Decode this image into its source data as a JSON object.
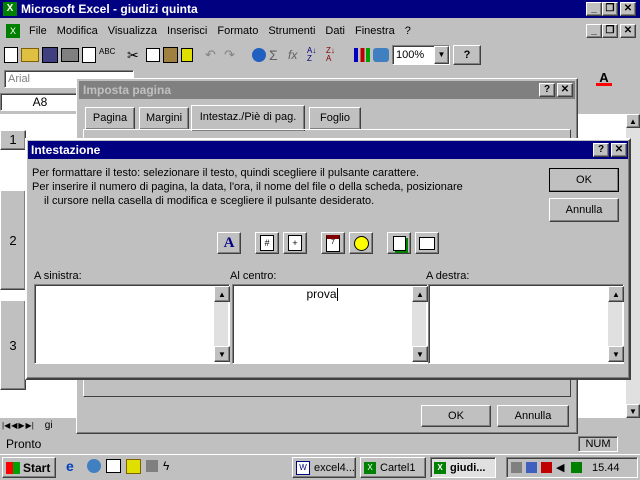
{
  "app": {
    "title": "Microsoft Excel - giudizi quinta",
    "menus": [
      "File",
      "Modifica",
      "Visualizza",
      "Inserisci",
      "Formato",
      "Strumenti",
      "Dati",
      "Finestra",
      "?"
    ],
    "zoom": "100%",
    "font_name": "Arial",
    "cell_ref": "A8",
    "row_numbers": [
      "1",
      "2",
      "3"
    ],
    "status": "Pronto",
    "num_indicator": "NUM",
    "sheet_tab": "gi"
  },
  "page_setup": {
    "title": "Imposta pagina",
    "tabs": [
      "Pagina",
      "Margini",
      "Intestaz./Piè di pag.",
      "Foglio"
    ],
    "ok_label": "OK",
    "cancel_label": "Annulla"
  },
  "header_dialog": {
    "title": "Intestazione",
    "instructions": [
      "Per formattare il testo: selezionare il testo, quindi scegliere il pulsante carattere.",
      "Per inserire il numero di pagina, la data, l'ora, il nome del file o della scheda, posizionare",
      "il cursore nella casella di modifica e scegliere il pulsante desiderato."
    ],
    "ok_label": "OK",
    "cancel_label": "Annulla",
    "left_label": "A sinistra:",
    "center_label": "Al centro:",
    "right_label": "A destra:",
    "left_value": "",
    "center_value": "prova",
    "right_value": ""
  },
  "taskbar": {
    "start_label": "Start",
    "tasks": [
      "excel4...",
      "Cartel1",
      "giudi..."
    ],
    "clock": "15.44"
  },
  "colors": {
    "title_active": "#000080",
    "desktop": "#008080",
    "font_color_bar": "#ff0000"
  }
}
